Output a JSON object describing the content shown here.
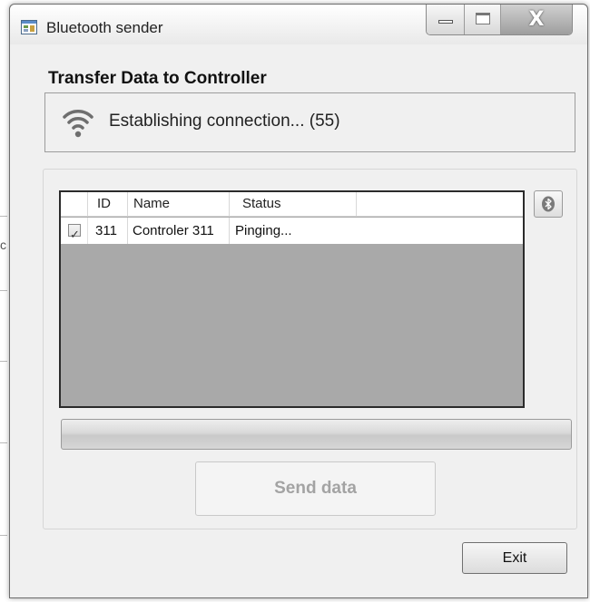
{
  "window": {
    "title": "Bluetooth sender",
    "caption_buttons": {
      "close_glyph": "X"
    }
  },
  "heading": "Transfer Data to Controller",
  "connection_status": {
    "icon": "wifi-icon",
    "text": "Establishing connection... (55)"
  },
  "device_list": {
    "columns": [
      "",
      "ID",
      "Name",
      "Status"
    ],
    "rows": [
      {
        "checked": true,
        "id": "311",
        "name": "Controler 311",
        "status": "Pinging..."
      }
    ]
  },
  "bluetooth_button": {
    "icon": "bluetooth-icon"
  },
  "progress": {
    "value": 0
  },
  "send_button_label": "Send data",
  "exit_button_label": "Exit",
  "background_fragments": [
    "c"
  ],
  "colors": {
    "list_background": "#a9a9a9",
    "window_background": "#f0f0f0",
    "disabled_text": "#a3a3a3"
  }
}
